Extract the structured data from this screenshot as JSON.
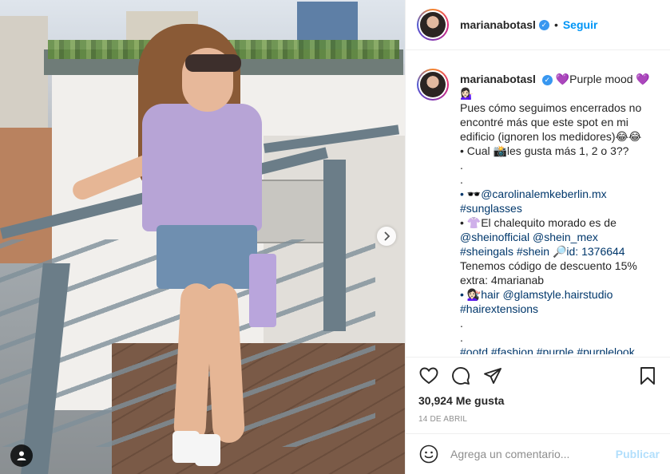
{
  "post": {
    "username": "marianabotasl",
    "verified_icon": "verified-badge-icon",
    "dot": "•",
    "follow_label": "Seguir"
  },
  "caption": {
    "username": "marianabotasl",
    "lines": [
      "💜Purple mood 💜",
      "💁🏻‍♀️",
      "Pues cómo seguimos encerrados no",
      "encontré más que este spot en mi",
      "edificio (ignoren los medidores)😂😂",
      "• Cual 📸les gusta más 1, 2 o 3??",
      ".",
      ".",
      "• 🕶️@carolinalemkeberlin.mx",
      "#sunglasses",
      "• 👚El chalequito morado es de",
      "@sheinofficial @shein_mex",
      "#sheingals #shein 🔎id: 1376644",
      "Tenemos código de descuento 15%",
      "extra: 4marianab",
      "• 💇🏻‍♀️hair @glamstyle.hairstudio",
      "#hairextensions",
      ".",
      ".",
      "#ootd #fashion #purple #purplelook"
    ]
  },
  "actions": {
    "icons": [
      "heart-icon",
      "comment-icon",
      "share-icon",
      "bookmark-icon"
    ],
    "likes": "30,924 Me gusta",
    "date": "14 DE ABRIL"
  },
  "comment": {
    "placeholder": "Agrega un comentario...",
    "publish_label": "Publicar"
  },
  "colors": {
    "link": "#00376b",
    "follow": "#0095f6",
    "publish_disabled": "#b2dffc",
    "muted": "#8e8e8e"
  }
}
